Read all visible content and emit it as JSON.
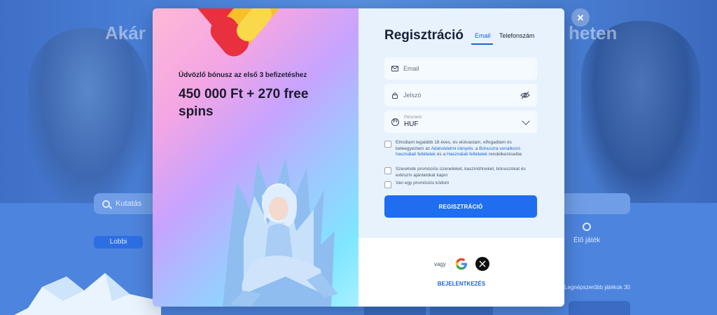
{
  "background": {
    "hero_title_left": "Akár",
    "hero_title_right": "heten",
    "search_placeholder": "Kutatás",
    "category_active": "Lobbi",
    "category_right": "Élő játék",
    "section_right": "Legnépszerűbb játékok 30"
  },
  "modal": {
    "promo": {
      "subtitle": "Üdvözlő bónusz az első 3 befizetéshez",
      "title": "450 000 Ft + 270 free spins"
    },
    "form": {
      "title": "Regisztráció",
      "tabs": {
        "email": "Email",
        "phone": "Telefonszám"
      },
      "email_placeholder": "Email",
      "password_placeholder": "Jelszó",
      "currency_label": "Pénznem",
      "currency_value": "HUF",
      "consent": {
        "part1": "Elmúltam legalább 18 éves, és elolvastam, elfogadtam és beleegyeztem az ",
        "link1": "Adatvédelmi irányelv",
        "part2": ", a ",
        "link2": "Bónuszra vonatkozó használati feltételek",
        "part3": " és a ",
        "link3": "Használati feltételek",
        "part4": " rendelkezéseibe"
      },
      "promo_consent": "Szeretnék promóciós üzeneteket, kaszinóhíreket, bónuszokat és exkluzív ajánlatokat kapni",
      "promo_code": "Van egy promóciós kódom",
      "submit_label": "REGISZTRÁCIÓ",
      "or_label": "vagy",
      "login_label": "BEJELENTKEZÉS"
    }
  },
  "icons": {
    "close": "close-icon",
    "email": "envelope-icon",
    "password": "lock-icon",
    "eye": "eye-off-icon",
    "currency": "currency-icon",
    "google": "google-icon",
    "x": "x-icon"
  },
  "colors": {
    "accent": "#1f6ef0",
    "link": "#1e63d8",
    "form_bg": "#e7f2fd"
  }
}
